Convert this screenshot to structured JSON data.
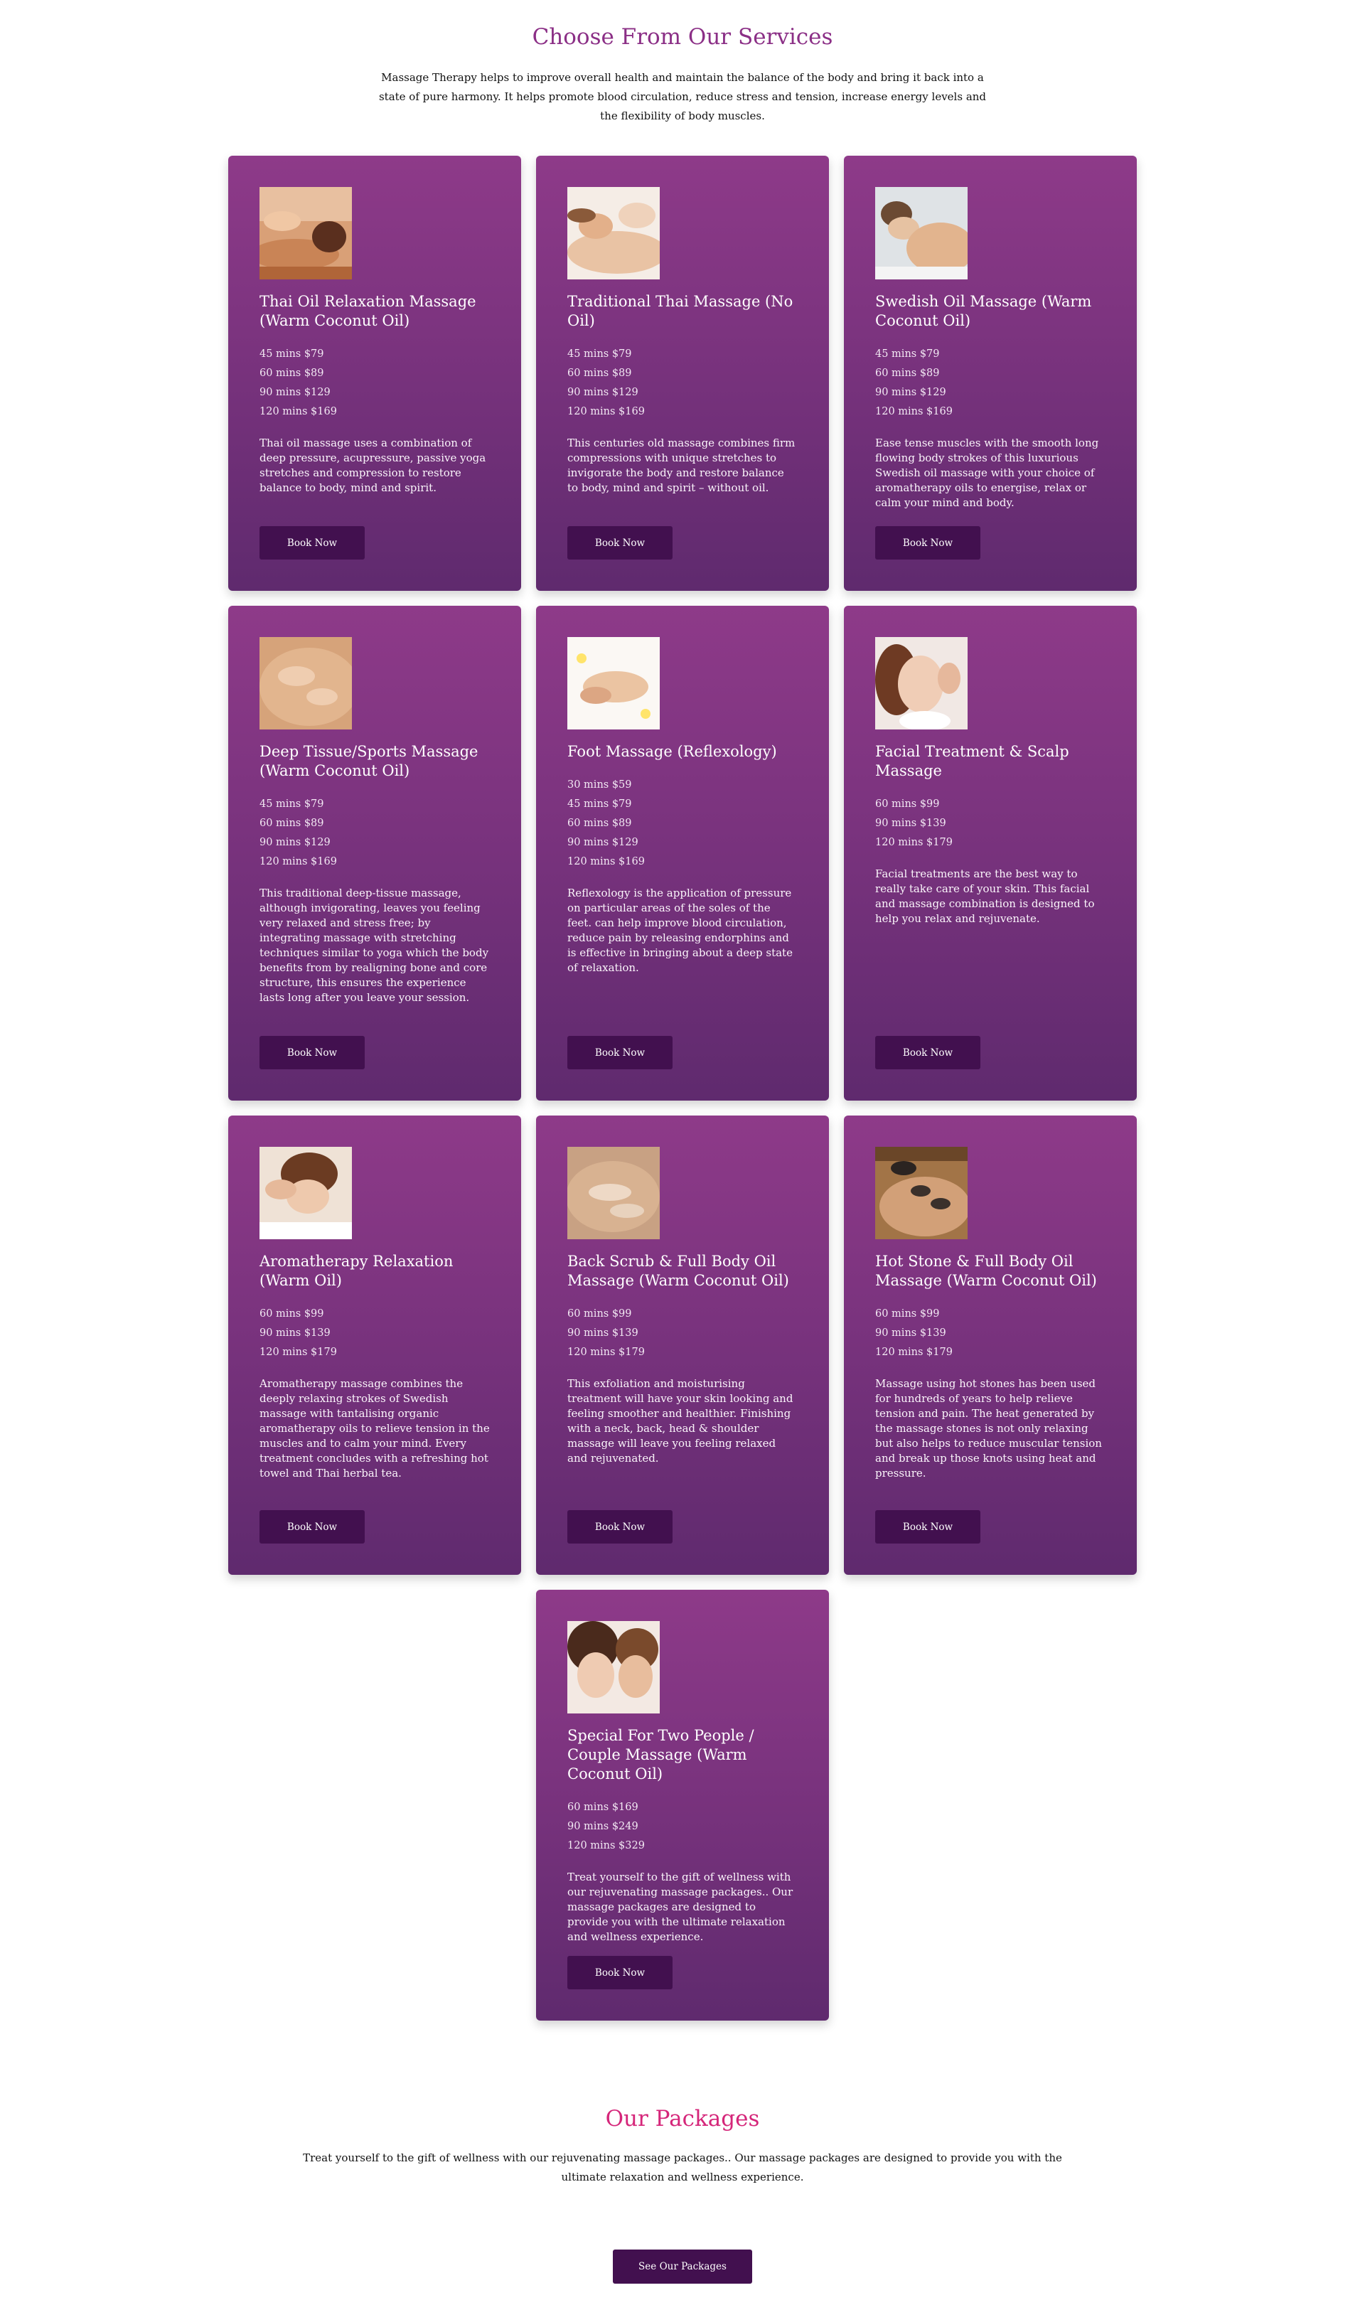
{
  "services": {
    "title": "Choose From Our Services",
    "intro": "Massage Therapy helps to improve overall health and maintain the balance of the body and bring it back into a state of pure harmony. It helps promote blood circulation, reduce stress and tension, increase energy levels and the flexibility of body muscles.",
    "book_label": "Book Now",
    "cards": [
      {
        "title": "Thai Oil Relaxation Massage (Warm Coconut Oil)",
        "prices": [
          "45 mins $79",
          "60 mins $89",
          "90 mins $129",
          "120 mins $169"
        ],
        "description": "Thai oil massage uses a combination of deep pressure, acupressure, passive yoga stretches and compression to restore balance to body, mind and spirit."
      },
      {
        "title": "Traditional Thai Massage (No Oil)",
        "prices": [
          "45 mins $79",
          "60 mins $89",
          "90 mins $129",
          "120 mins $169"
        ],
        "description": "This centuries old massage combines firm compressions with unique stretches to invigorate the body and restore balance to body, mind and spirit – without oil."
      },
      {
        "title": "Swedish Oil Massage (Warm Coconut Oil)",
        "prices": [
          "45 mins $79",
          "60 mins $89",
          "90 mins $129",
          "120 mins $169"
        ],
        "description": "Ease tense muscles with the smooth long flowing body strokes of this luxurious Swedish oil massage with your choice of aromatherapy oils to energise, relax or calm your mind and body."
      },
      {
        "title": "Deep Tissue/Sports Massage (Warm Coconut Oil)",
        "prices": [
          "45 mins $79",
          "60 mins $89",
          "90 mins $129",
          "120 mins $169"
        ],
        "description": "This traditional deep-tissue massage, although invigorating, leaves you feeling very relaxed and stress free; by integrating massage with stretching techniques similar to yoga which the body benefits from by realigning bone and core structure, this ensures the experience lasts long after you leave your session."
      },
      {
        "title": "Foot Massage (Reflexology)",
        "prices": [
          "30 mins $59",
          "45 mins $79",
          "60 mins $89",
          "90 mins $129",
          "120 mins $169"
        ],
        "description": "Reflexology is the application of pressure on particular areas of the soles of the feet. can help improve blood circulation, reduce pain by releasing endorphins and is effective in bringing about a deep state of relaxation."
      },
      {
        "title": "Facial Treatment & Scalp Massage",
        "prices": [
          "60 mins $99",
          "90 mins $139",
          "120 mins $179"
        ],
        "description": "Facial treatments are the best way to really take care of your skin. This facial and massage combination is designed to help you relax and rejuvenate."
      },
      {
        "title": "Aromatherapy Relaxation (Warm Oil)",
        "prices": [
          "60 mins $99",
          "90 mins $139",
          "120 mins $179"
        ],
        "description": "Aromatherapy massage combines the deeply relaxing strokes of Swedish massage with tantalising organic aromatherapy oils to relieve tension in the muscles and to calm your mind. Every treatment concludes with a refreshing hot towel and Thai herbal tea."
      },
      {
        "title": "Back Scrub & Full Body Oil Massage (Warm Coconut Oil)",
        "prices": [
          "60 mins $99",
          "90 mins $139",
          "120 mins $179"
        ],
        "description": "This exfoliation and moisturising treatment will have your skin looking and feeling smoother and healthier. Finishing with a neck, back, head & shoulder massage will leave you feeling relaxed and rejuvenated."
      },
      {
        "title": "Hot Stone & Full Body Oil Massage (Warm Coconut Oil)",
        "prices": [
          "60 mins $99",
          "90 mins $139",
          "120 mins $179"
        ],
        "description": "Massage using hot stones has been used for hundreds of years to help relieve tension and pain. The heat generated by the massage stones is not only relaxing but also helps to reduce muscular tension and break up those knots using heat and pressure."
      },
      {
        "title": "Special For Two People / Couple Massage (Warm Coconut Oil)",
        "prices": [
          "60 mins $169",
          "90 mins $249",
          "120 mins $329"
        ],
        "description": "Treat yourself to the gift of wellness with our rejuvenating massage packages.. Our massage packages are designed to provide you with the ultimate relaxation and wellness experience."
      }
    ]
  },
  "packages": {
    "title": "Our Packages",
    "intro": "Treat yourself to the gift of wellness with our rejuvenating massage packages.. Our massage packages are designed to provide you with the ultimate relaxation and wellness experience.",
    "button_label": "See Our Packages"
  },
  "colors": {
    "services_title": "#8b2f86",
    "packages_title": "#d5267a",
    "card_top": "#8e3a89",
    "card_bottom": "#5f2a6e",
    "button": "#42104f"
  }
}
